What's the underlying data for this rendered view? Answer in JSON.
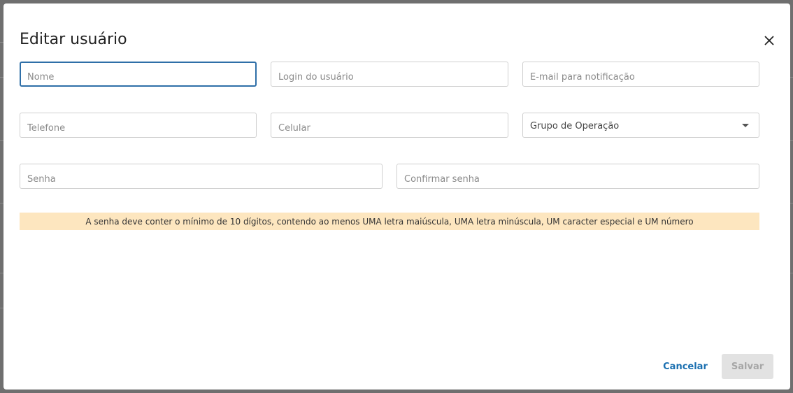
{
  "dialog": {
    "title": "Editar usuário",
    "close_label": "×"
  },
  "fields": {
    "nome": {
      "placeholder": "Nome"
    },
    "login": {
      "placeholder": "Login do usuário"
    },
    "email": {
      "placeholder": "E-mail para notificação"
    },
    "telefone": {
      "placeholder": "Telefone"
    },
    "celular": {
      "placeholder": "Celular"
    },
    "grupo": {
      "value": "Grupo de Operação"
    },
    "senha": {
      "placeholder": "Senha"
    },
    "confirmar": {
      "placeholder": "Confirmar senha"
    }
  },
  "notice": {
    "text": "A senha deve conter o mínimo de 10 dígitos, contendo ao menos UMA letra maiúscula, UMA letra minúscula, UM caracter especial e UM número"
  },
  "actions": {
    "cancel_label": "Cancelar",
    "save_label": "Salvar"
  },
  "colors": {
    "focus_border": "#2f6fa8",
    "link": "#1a6fb0",
    "notice_bg": "#fde6bf",
    "disabled_bg": "#e2e2e2"
  }
}
